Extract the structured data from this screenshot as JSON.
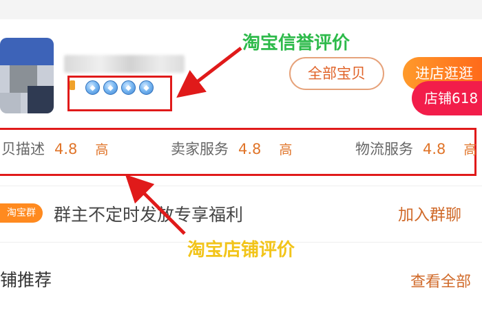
{
  "annotations": {
    "credit_label": "淘宝信誉评价",
    "store_rating_label": "淘宝店铺评价"
  },
  "shop": {
    "credit_level_icons": [
      "diamond-icon",
      "diamond-icon",
      "diamond-icon",
      "diamond-icon"
    ],
    "buttons": {
      "all_items": "全部宝贝",
      "enter_store": "进店逛逛",
      "store_promo": "店铺618"
    }
  },
  "ratings": [
    {
      "label": "贝描述",
      "value": "4.8",
      "level": "高"
    },
    {
      "label": "卖家服务",
      "value": "4.8",
      "level": "高"
    },
    {
      "label": "物流服务",
      "value": "4.8",
      "level": "高"
    }
  ],
  "fans_group": {
    "badge": "淘宝群",
    "text": "群主不定时发放专享福利",
    "join": "加入群聊"
  },
  "recommend": {
    "title": "铺推荐",
    "view_all": "查看全部"
  },
  "colors": {
    "annotation_red": "#e01a1a",
    "annotation_green": "#2dba4a",
    "annotation_yellow": "#f2c419",
    "accent_orange": "#e0752a",
    "promo_red": "#f21d4a"
  }
}
